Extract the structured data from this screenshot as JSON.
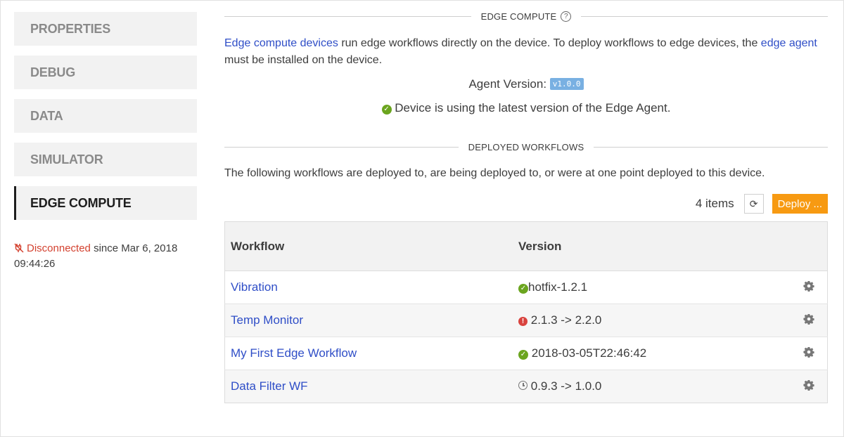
{
  "sidebar": {
    "items": [
      {
        "label": "PROPERTIES"
      },
      {
        "label": "DEBUG"
      },
      {
        "label": "DATA"
      },
      {
        "label": "SIMULATOR"
      },
      {
        "label": "EDGE COMPUTE"
      }
    ],
    "connection": {
      "status": "Disconnected",
      "since_text": "since Mar 6, 2018",
      "time": "09:44:26"
    }
  },
  "edge_compute": {
    "heading": "EDGE COMPUTE",
    "intro_link1": "Edge compute devices",
    "intro_text1": " run edge workflows directly on the device. To deploy workflows to edge devices, the ",
    "intro_link2": "edge agent",
    "intro_text2": " must be installed on the device.",
    "agent_label": "Agent Version:",
    "agent_version": "v1.0.0",
    "status_text": "Device is using the latest version of the Edge Agent."
  },
  "deployed": {
    "heading": "DEPLOYED WORKFLOWS",
    "description": "The following workflows are deployed to, are being deployed to, or were at one point deployed to this device.",
    "count": "4 items",
    "deploy_label": "Deploy ...",
    "columns": [
      "Workflow",
      "Version"
    ],
    "rows": [
      {
        "workflow": "Vibration",
        "version": "hotfix-1.2.1",
        "status_icon": "check-circle-icon"
      },
      {
        "workflow": "Temp Monitor",
        "version": "2.1.3 -> 2.2.0",
        "status_icon": "error-circle-icon"
      },
      {
        "workflow": "My First Edge Workflow",
        "version": "2018-03-05T22:46:42",
        "status_icon": "check-circle-icon"
      },
      {
        "workflow": "Data Filter WF",
        "version": "0.9.3 -> 1.0.0",
        "status_icon": "clock-icon"
      }
    ]
  },
  "colors": {
    "link": "#2f4ec7",
    "deploy_button": "#f79a12",
    "ok": "#6ba51f",
    "error": "#d9433e",
    "disconnected": "#d3412f",
    "badge": "#79b0e2"
  }
}
